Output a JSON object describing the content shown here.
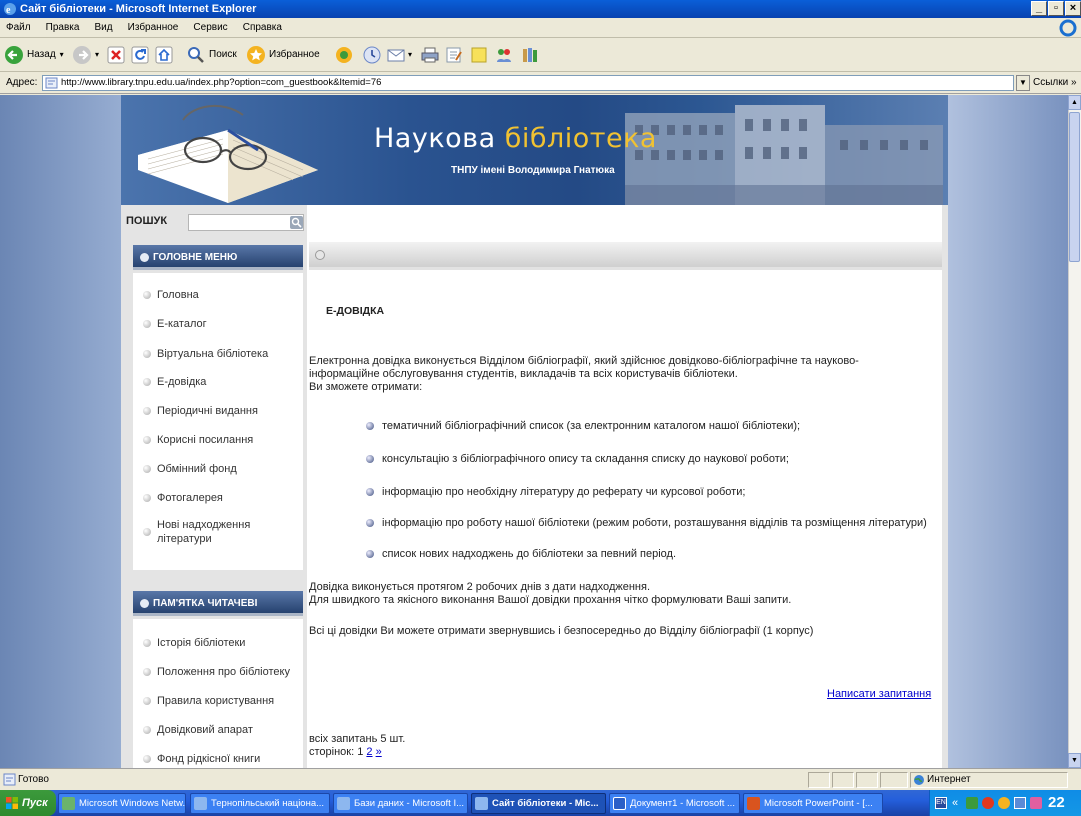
{
  "window": {
    "title": "Сайт бібліотеки - Microsoft Internet Explorer"
  },
  "menubar": {
    "items": [
      "Файл",
      "Правка",
      "Вид",
      "Избранное",
      "Сервис",
      "Справка"
    ]
  },
  "toolbar": {
    "back_label": "Назад",
    "search_label": "Поиск",
    "favorites_label": "Избранное"
  },
  "addressbar": {
    "label": "Адрес:",
    "url": "http://www.library.tnpu.edu.ua/index.php?option=com_guestbook&Itemid=76",
    "links_label": "Ссылки"
  },
  "site": {
    "brand_part1": "Наукова ",
    "brand_part2": "бібліотека",
    "brand_sub": "ТНПУ імені Володимира Гнатюка",
    "search_label": "ПОШУК",
    "main_menu": {
      "title": "ГОЛОВНЕ МЕНЮ",
      "items": [
        "Головна",
        "Е-каталог",
        "Віртуальна бібліотека",
        "Е-довідка",
        "Періодичні видання",
        "Корисні посилання",
        "Обмінний фонд",
        "Фотогалерея",
        "Нові надходження літератури"
      ]
    },
    "reader_menu": {
      "title": "ПАМ'ЯТКА ЧИТАЧЕВІ",
      "items": [
        "Історія бібліотеки",
        "Положення про бібліотеку",
        "Правила користування",
        "Довідковий апарат",
        "Фонд рідкісної книги"
      ]
    }
  },
  "content": {
    "title": "Е-ДОВІДКА",
    "intro": "Електронна довідка виконується Відділом бібліографії, який здійснює довідково-бібліографічне та науково-інформаційне обслуговування студентів, викладачів та всіх користувачів бібліотеки.",
    "can_get": "Ви зможете отримати:",
    "bullets": [
      "тематичний бібліографічний список (за електронним каталогом нашої бібліотеки);",
      "консультацію з бібліографічного опису та складання списку до наукової роботи;",
      "інформацію про необхідну літературу до реферату чи курсової роботи;",
      "інформацію про роботу нашої бібліотеки (режим роботи, розташування відділів та розміщення літератури)",
      "список нових надходжень до бібліотеки за певний період."
    ],
    "note1": "Довідка виконується протягом 2 робочих днів з дати надходження.",
    "note2": "Для швидкого та якісного виконання Вашої довідки прохання чітко формулювати Ваші запити.",
    "note3": "Всі ці довідки Ви можете отримати звернувшись і безпосередньо до Відділу бібліографії (1 корпус)",
    "ask_link": "Написати запитання",
    "total": "всіх запитань 5 шт.",
    "pages_label": "сторінок: 1",
    "page2": "2",
    "next": "»"
  },
  "status": {
    "text": "Готово",
    "zone": "Интернет"
  },
  "taskbar": {
    "start": "Пуск",
    "tasks": [
      "Microsoft Windows Netw...",
      "Тернопільський націона...",
      "Бази даних - Microsoft I...",
      "Сайт бібліотеки - Mic...",
      "Документ1 - Microsoft ...",
      "Microsoft PowerPoint - [..."
    ],
    "clock": "22"
  }
}
